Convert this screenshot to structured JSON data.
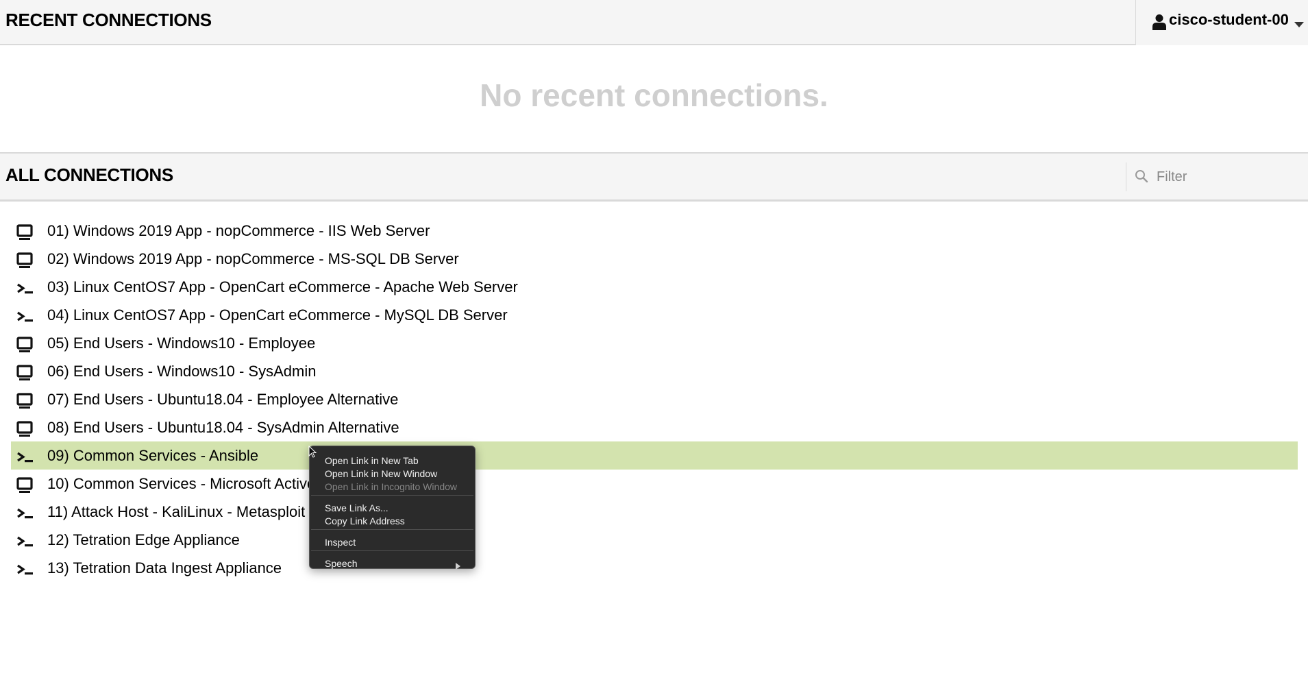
{
  "recent": {
    "title": "RECENT CONNECTIONS",
    "empty_message": "No recent connections."
  },
  "user_menu": {
    "username": "cisco-student-00",
    "icon": "user-icon"
  },
  "all": {
    "title": "ALL CONNECTIONS",
    "filter_placeholder": "Filter"
  },
  "connections": [
    {
      "label": "01) Windows 2019 App - nopCommerce - IIS Web Server",
      "icon": "desktop-icon"
    },
    {
      "label": "02) Windows 2019 App - nopCommerce - MS-SQL DB Server",
      "icon": "desktop-icon"
    },
    {
      "label": "03) Linux CentOS7 App - OpenCart eCommerce - Apache Web Server",
      "icon": "terminal-icon"
    },
    {
      "label": "04) Linux CentOS7 App - OpenCart eCommerce - MySQL DB Server",
      "icon": "terminal-icon"
    },
    {
      "label": "05) End Users - Windows10 - Employee",
      "icon": "desktop-icon"
    },
    {
      "label": "06) End Users - Windows10 - SysAdmin",
      "icon": "desktop-icon"
    },
    {
      "label": "07) End Users - Ubuntu18.04 - Employee Alternative",
      "icon": "desktop-icon"
    },
    {
      "label": "08) End Users - Ubuntu18.04 - SysAdmin Alternative",
      "icon": "desktop-icon"
    },
    {
      "label": "09) Common Services - Ansible",
      "icon": "terminal-icon",
      "selected": true
    },
    {
      "label": "10) Common Services - Microsoft Active",
      "icon": "desktop-icon"
    },
    {
      "label": "11) Attack Host - KaliLinux - Metasploit",
      "icon": "terminal-icon"
    },
    {
      "label": "12) Tetration Edge Appliance",
      "icon": "terminal-icon"
    },
    {
      "label": "13) Tetration Data Ingest Appliance",
      "icon": "terminal-icon"
    }
  ],
  "context_menu": {
    "items": [
      {
        "label": "Open Link in New Tab",
        "enabled": true
      },
      {
        "label": "Open Link in New Window",
        "enabled": true
      },
      {
        "label": "Open Link in Incognito Window",
        "enabled": false
      },
      {
        "label": "Save Link As...",
        "enabled": true
      },
      {
        "label": "Copy Link Address",
        "enabled": true
      },
      {
        "label": "Inspect",
        "enabled": true
      },
      {
        "label": "Speech",
        "enabled": true,
        "submenu": true
      }
    ]
  },
  "colors": {
    "selected_row": "#d3e3ae",
    "header_bg": "#f5f5f5",
    "empty_text": "#cfcfcf",
    "menu_bg": "#2b2b2b"
  }
}
